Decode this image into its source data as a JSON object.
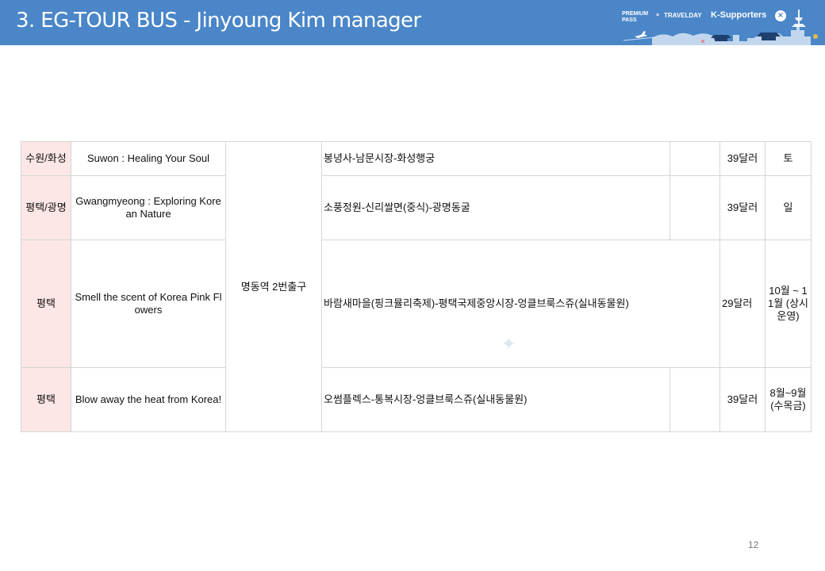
{
  "header": {
    "title": "3. EG-TOUR BUS - Jinyoung Kim manager",
    "brand": {
      "premium_pass": "PREMIUM PASS",
      "x": "×",
      "travelday": "TRAVELDAY",
      "k_supporters": "K-Supporters",
      "close_glyph": "×"
    }
  },
  "table": {
    "meeting_point": "명동역 2번출구",
    "rows": [
      {
        "region": "수원/화성",
        "tour_name": "Suwon : Healing Your Soul",
        "route": "봉녕사-남문시장-화성행궁",
        "price": "39달러",
        "day": "토"
      },
      {
        "region": "평택/광명",
        "tour_name": "Gwangmyeong : Exploring Korean Nature",
        "route": "소풍정원-신리쌀면(중식)-광명동굴",
        "price": "39달러",
        "day": "일"
      },
      {
        "region": "평택",
        "tour_name": "Smell the scent of Korea Pink Flowers",
        "route": "바람새마을(핑크뮬리축제)-평택국제중앙시장-엉클브룩스쥬(실내동물원)",
        "price": "29달러",
        "day": "10월 ~ 11월 (상시운영)"
      },
      {
        "region": "평택",
        "tour_name": "Blow away the heat from Korea!",
        "route": "오썸플렉스-통복시장-엉클브룩스쥬(실내동물원)",
        "price": "39달러",
        "day": "8월~9월 (수목금)"
      }
    ]
  },
  "decorations": {
    "sparkle_glyph": "✦"
  },
  "footer": {
    "page_number": "12"
  },
  "colors": {
    "header_bg": "#4a86c8",
    "region_bg": "#fce6e6",
    "border": "#d6d6d6"
  }
}
